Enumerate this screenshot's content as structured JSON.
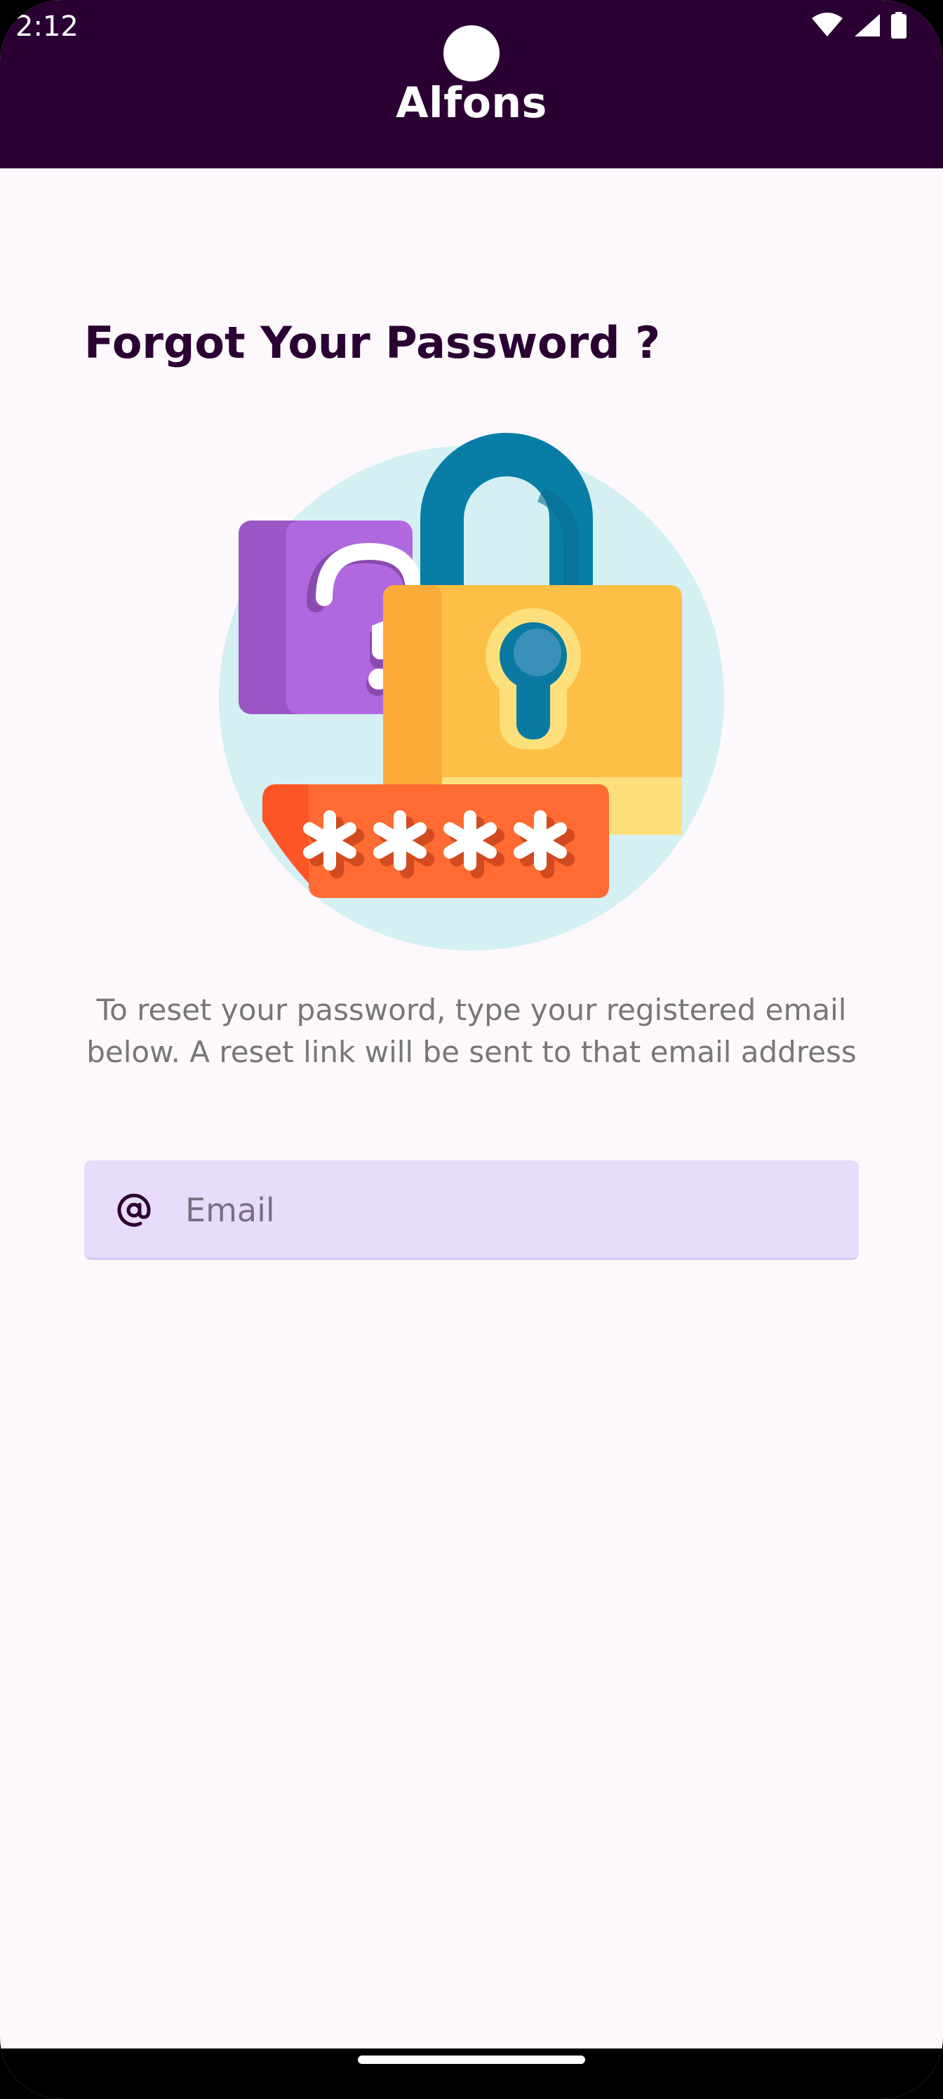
{
  "status_bar": {
    "time": "2:12",
    "icons": [
      "wifi-icon",
      "signal-icon",
      "battery-icon"
    ]
  },
  "app_bar": {
    "title": "Alfons"
  },
  "page": {
    "title": "Forgot Your Password ?",
    "illustration": "password-lock-illustration",
    "description": "To reset your password, type your registered email below. A reset link will be sent to that email address"
  },
  "email_field": {
    "icon": "at-sign-icon",
    "placeholder": "Email",
    "value": ""
  },
  "colors": {
    "primary_dark": "#2b0033",
    "background": "#fdf8fc",
    "field_background": "#e8dcfb",
    "description_text": "#777777"
  }
}
